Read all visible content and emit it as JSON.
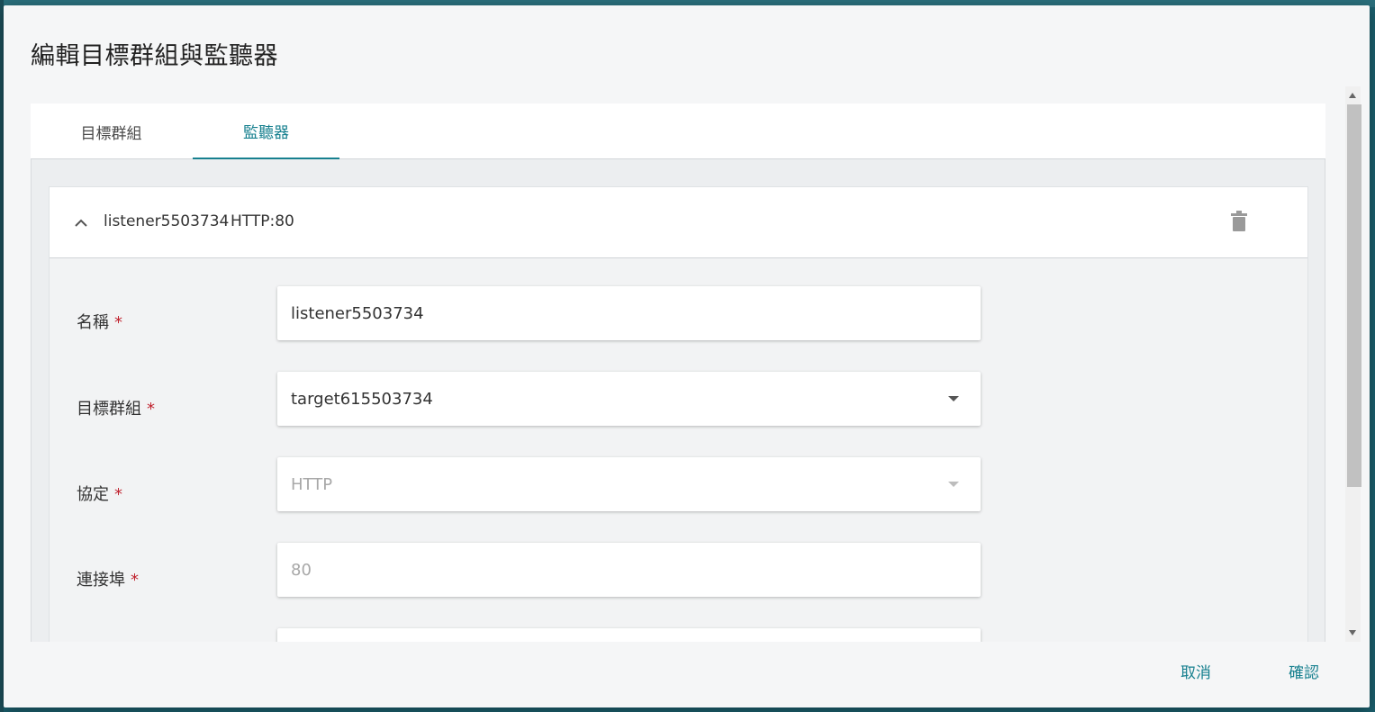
{
  "dialog": {
    "title": "編輯目標群組與監聽器"
  },
  "tabs": [
    {
      "label": "目標群組",
      "active": false
    },
    {
      "label": "監聽器",
      "active": true
    }
  ],
  "listener_card": {
    "name": "listener5503734",
    "summary": "HTTP:80",
    "expand_icon": "chevron-up-icon",
    "delete_icon": "trash-icon"
  },
  "form": {
    "required_mark": "*",
    "name": {
      "label": "名稱",
      "value": "listener5503734"
    },
    "target_group": {
      "label": "目標群組",
      "value": "target615503734"
    },
    "protocol": {
      "label": "協定",
      "value": "HTTP"
    },
    "port": {
      "label": "連接埠",
      "value": "80"
    }
  },
  "footer": {
    "cancel_label": "取消",
    "confirm_label": "確認"
  },
  "colors": {
    "accent": "#17808f",
    "required": "#c0232f"
  }
}
